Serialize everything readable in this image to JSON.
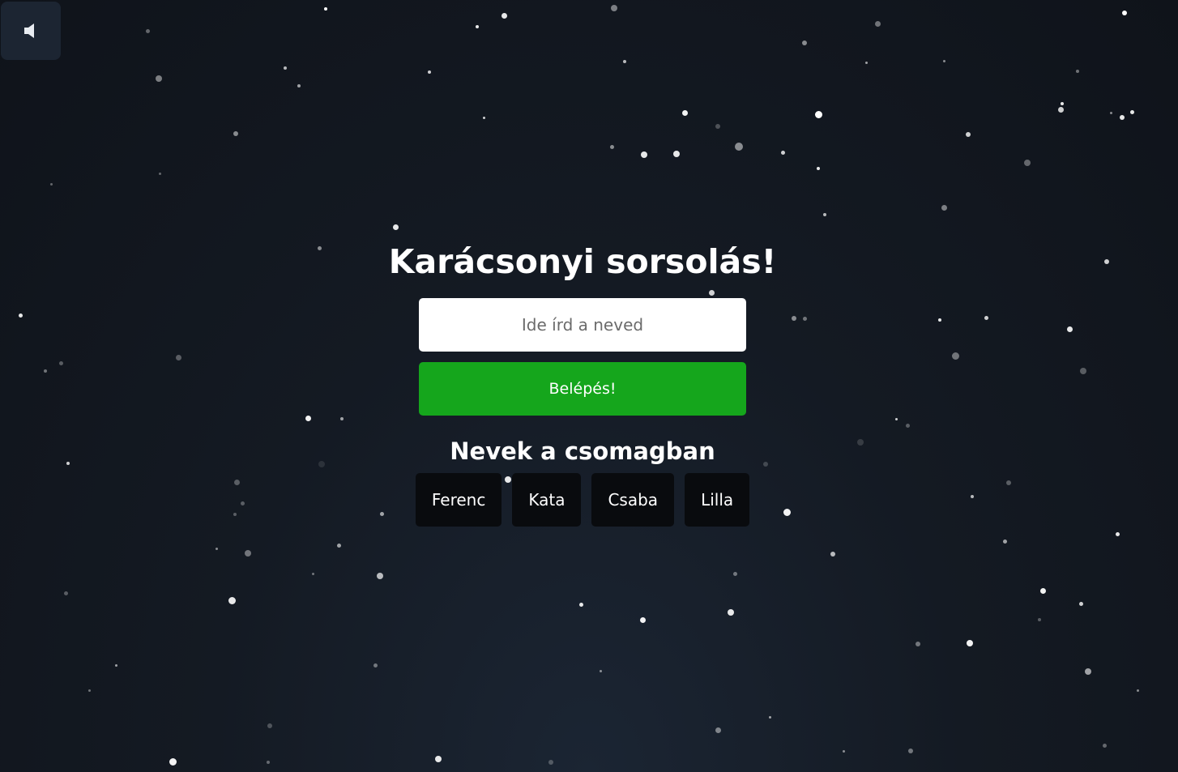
{
  "sound_toggle": {
    "icon": "speaker-muted-icon"
  },
  "login": {
    "title": "Karácsonyi sorsolás!",
    "name_placeholder": "Ide írd a neved",
    "name_value": "",
    "enter_label": "Belépés!",
    "enter_color": "#15a61c"
  },
  "pool": {
    "heading": "Nevek a csomagban",
    "names": [
      "Ferenc",
      "Kata",
      "Csaba",
      "Lilla"
    ]
  },
  "colors": {
    "background": "#141a23",
    "chip_background": "#090b0e",
    "sound_button_background": "#1c2532"
  }
}
